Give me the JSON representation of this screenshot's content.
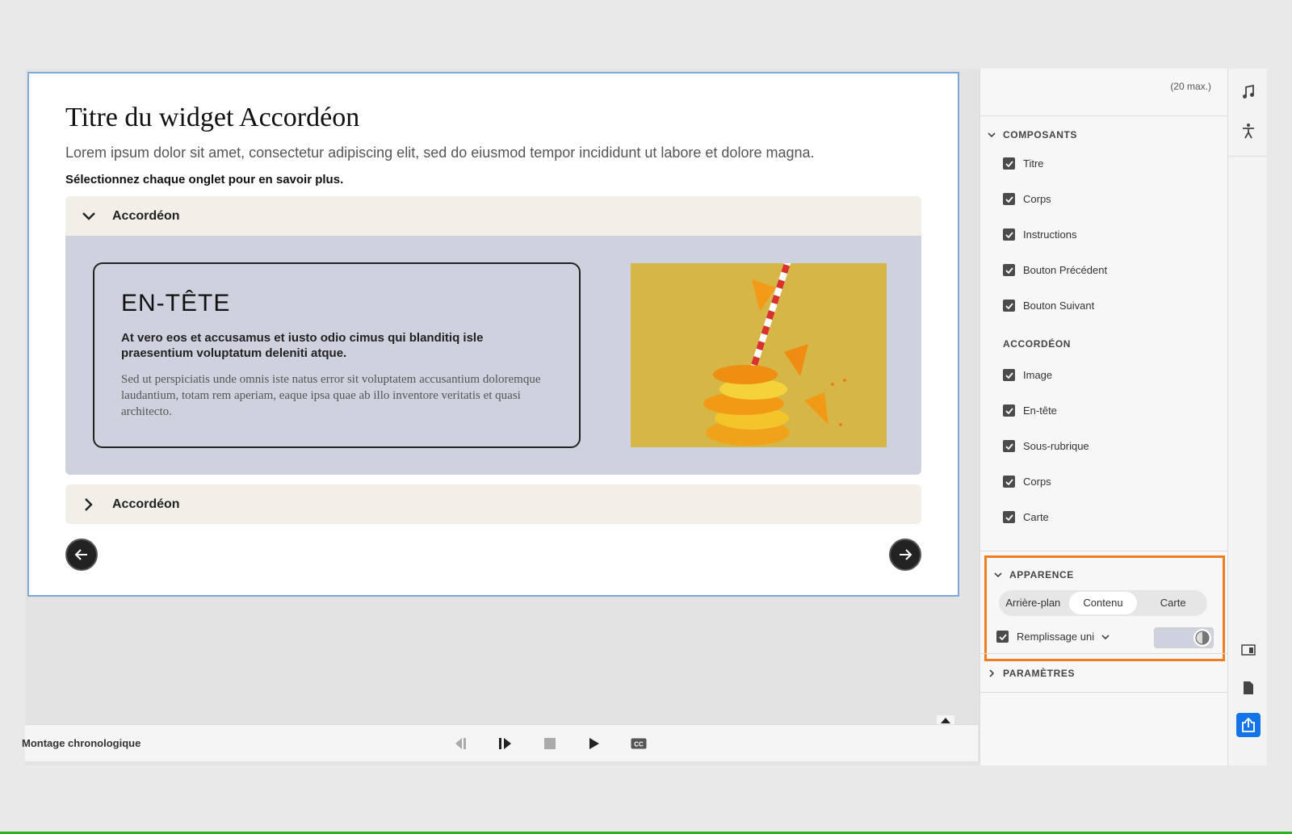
{
  "slide": {
    "title": "Titre du widget Accordéon",
    "body": "Lorem ipsum dolor sit amet, consectetur adipiscing elit, sed do eiusmod tempor incididunt ut labore et dolore magna.",
    "instructions": "Sélectionnez chaque onglet pour en savoir plus.",
    "accordion": [
      {
        "label": "Accordéon",
        "expanded": true,
        "heading": "EN-TÊTE",
        "subheading": "At vero eos et accusamus et iusto odio cimus qui blanditiq isle praesentium voluptatum deleniti atque.",
        "text": "Sed ut perspiciatis unde omnis iste natus error sit voluptatem accusantium doloremque laudantium, totam rem aperiam, eaque ipsa quae ab illo inventore veritatis et quasi architecto."
      },
      {
        "label": "Accordéon",
        "expanded": false
      }
    ],
    "colors": {
      "header_bg": "#f1efe8",
      "content_bg": "#ced2de",
      "image_bg": "#d7b544"
    }
  },
  "timeline": {
    "label": "Montage chronologique"
  },
  "panel": {
    "max_note": "(20 max.)",
    "composants": {
      "title": "COMPOSANTS",
      "items": [
        "Titre",
        "Corps",
        "Instructions",
        "Bouton Précédent",
        "Bouton Suivant"
      ],
      "accordeon_title": "ACCORDÉON",
      "accordeon_items": [
        "Image",
        "En-tête",
        "Sous-rubrique",
        "Corps",
        "Carte"
      ]
    },
    "apparence": {
      "title": "APPARENCE",
      "tabs": [
        "Arrière-plan",
        "Contenu",
        "Carte"
      ],
      "active_tab": "Contenu",
      "fill_label": "Remplissage uni",
      "fill_color": "#ced2de",
      "highlight_color": "#f07d1e"
    },
    "parametres": {
      "title": "PARAMÈTRES"
    }
  }
}
